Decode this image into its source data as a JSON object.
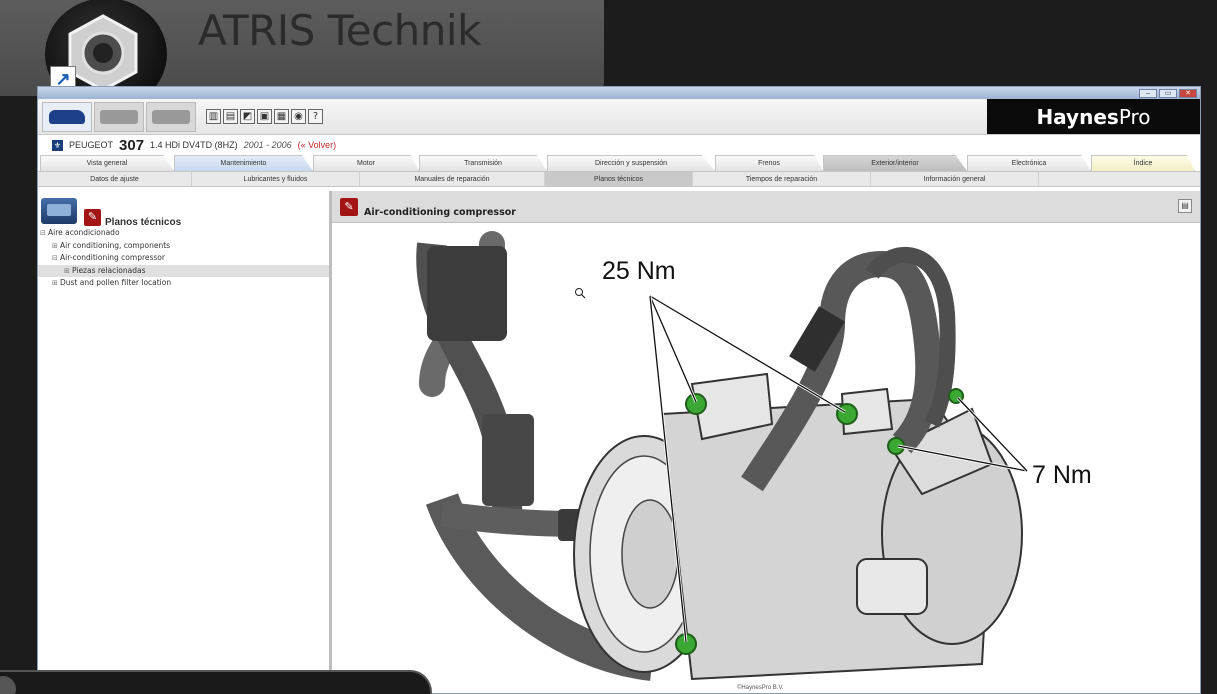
{
  "banner": {
    "title": "ATRIS Technik",
    "logo": "atris-hex-nut-logo",
    "shortcut": "shortcut-arrow-icon"
  },
  "window": {
    "controls": {
      "minimize": "–",
      "restore": "▭",
      "close": "✕"
    }
  },
  "toolbar": {
    "icons": [
      "book-icon",
      "page-icon",
      "wrench-icon",
      "document-icon",
      "calculator-icon",
      "gear-icon",
      "help-icon"
    ],
    "icon_glyphs": [
      "▥",
      "▤",
      "◩",
      "▣",
      "▦",
      "◉",
      "?"
    ],
    "brand_haynes": "Haynes",
    "brand_pro": "Pro"
  },
  "vehicle": {
    "make": "PEUGEOT",
    "model": "307",
    "engine": "1.4 HDi DV4TD (8HZ)",
    "years": "2001 - 2006",
    "back": "(« Volver)"
  },
  "tabs": [
    {
      "label": "Vista general",
      "w": 134,
      "state": ""
    },
    {
      "label": "Mantenimiento",
      "w": 139,
      "state": "active"
    },
    {
      "label": "Motor",
      "w": 106,
      "state": ""
    },
    {
      "label": "Transmisión",
      "w": 128,
      "state": ""
    },
    {
      "label": "Dirección y suspensión",
      "w": 168,
      "state": ""
    },
    {
      "label": "Frenos",
      "w": 108,
      "state": ""
    },
    {
      "label": "Exterior/interior",
      "w": 144,
      "state": "dark"
    },
    {
      "label": "Electrónica",
      "w": 124,
      "state": ""
    },
    {
      "label": "Índice",
      "w": 104,
      "state": "yellow"
    }
  ],
  "subtabs": [
    {
      "label": "Datos de ajuste",
      "w": 154,
      "state": ""
    },
    {
      "label": "Lubricantes y fluidos",
      "w": 168,
      "state": ""
    },
    {
      "label": "Manuales de reparación",
      "w": 185,
      "state": ""
    },
    {
      "label": "Planos técnicos",
      "w": 148,
      "state": "active"
    },
    {
      "label": "Tiempos de reparación",
      "w": 178,
      "state": ""
    },
    {
      "label": "Información general",
      "w": 168,
      "state": ""
    }
  ],
  "sidebar": {
    "title": "Planos técnicos",
    "tree": [
      {
        "label": "Aire acondicionado",
        "exp": "⊟",
        "indent": 2,
        "sel": false
      },
      {
        "label": "Air conditioning, components",
        "exp": "⊞",
        "indent": 14,
        "sel": false
      },
      {
        "label": "Air-conditioning compressor",
        "exp": "⊟",
        "indent": 14,
        "sel": false
      },
      {
        "label": "Piezas relacionadas",
        "exp": "⊞",
        "indent": 26,
        "sel": true
      },
      {
        "label": "Dust and pollen filter location",
        "exp": "⊞",
        "indent": 14,
        "sel": false
      }
    ]
  },
  "main": {
    "title": "Air-conditioning compressor",
    "print_icon": "print-icon",
    "figure": {
      "torque_top": "25 Nm",
      "torque_right": "7 Nm"
    },
    "copyright": "©HaynesPro B.V."
  },
  "colors": {
    "accent_red": "#a31414",
    "bolt_green": "#3aa832",
    "brand_black": "#0a0a0a"
  }
}
